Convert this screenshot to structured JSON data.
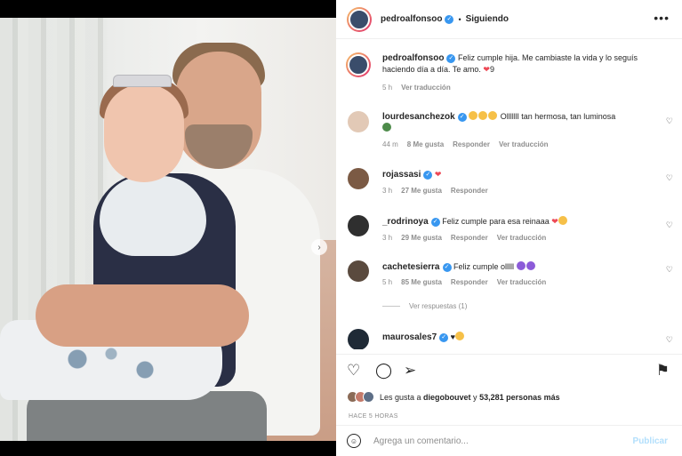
{
  "post": {
    "username": "pedroalfonsoo",
    "follow_status": "Siguiendo",
    "caption_user": "pedroalfonsoo",
    "caption": "Feliz cumple hija. Me cambiaste la vida y lo seguís haciendo día a día. Te amo. ",
    "caption_suffix": "9",
    "caption_time": "5 h",
    "translate": "Ver traducción"
  },
  "comments": [
    {
      "user": "lourdesanchezok",
      "text": "Olllllll tan hermosa, tan luminosa",
      "time": "44 m",
      "likes": "8 Me gusta",
      "reply": "Responder",
      "translate": "Ver traducción"
    },
    {
      "user": "rojassasi",
      "text": "",
      "time": "3 h",
      "likes": "27 Me gusta",
      "reply": "Responder"
    },
    {
      "user": "_rodrinoya",
      "text": "Feliz cumple para esa reinaaa",
      "time": "3 h",
      "likes": "29 Me gusta",
      "reply": "Responder",
      "translate": "Ver traducción"
    },
    {
      "user": "cachetesierra",
      "text": "Feliz cumple olllll",
      "time": "5 h",
      "likes": "85 Me gusta",
      "reply": "Responder",
      "translate": "Ver traducción"
    },
    {
      "user": "maurosales7",
      "text": "♥"
    }
  ],
  "view_replies": "Ver respuestas (1)",
  "likes_prefix": "Les gusta a ",
  "likes_user": "diegobouvet",
  "likes_mid": " y ",
  "likes_count": "53,281 personas más",
  "post_time": "HACE 5 HORAS",
  "composer": {
    "placeholder": "Agrega un comentario...",
    "publish": "Publicar"
  },
  "colors": {
    "verified": "#3897f0",
    "heart": "#ed4956",
    "publish": "#b2dffc"
  },
  "carousel": {
    "slides": 3,
    "active": 1
  }
}
